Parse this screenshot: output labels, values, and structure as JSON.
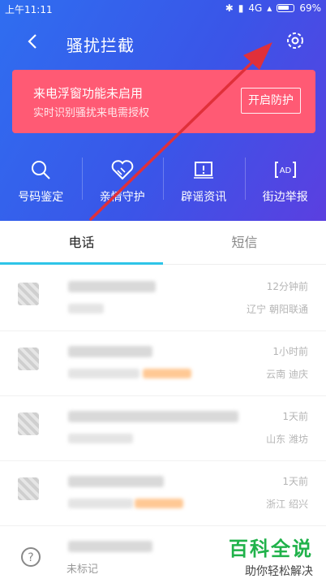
{
  "status_bar": {
    "time": "上午11:11",
    "network": "4G",
    "battery": "69%"
  },
  "header": {
    "title": "骚扰拦截"
  },
  "banner": {
    "line1": "来电浮窗功能未启用",
    "line2": "实时识别骚扰来电需授权",
    "button": "开启防护"
  },
  "features": [
    {
      "label": "号码鉴定",
      "icon": "search-icon"
    },
    {
      "label": "亲情守护",
      "icon": "heart-icon"
    },
    {
      "label": "辟谣资讯",
      "icon": "exclamation-card-icon"
    },
    {
      "label": "街边举报",
      "icon": "ad-icon"
    }
  ],
  "tabs": [
    {
      "label": "电话",
      "active": true
    },
    {
      "label": "短信",
      "active": false
    }
  ],
  "calls": [
    {
      "time": "12分钟前",
      "location": "辽宁 朝阳联通"
    },
    {
      "time": "1小时前",
      "location": "云南 迪庆"
    },
    {
      "time": "1天前",
      "location": "山东 潍坊"
    },
    {
      "time": "1天前",
      "location": "浙江 绍兴"
    }
  ],
  "last_row_tag": "未标记",
  "watermark": {
    "title": "百科全说",
    "subtitle": "助你轻松解决"
  },
  "colors": {
    "header_gradient_start": "#2f6ef0",
    "header_gradient_end": "#5b3fe0",
    "banner": "#ff5a74",
    "tab_underline": "#2ec4e8",
    "arrow": "#e0303a",
    "watermark": "#20b24a"
  }
}
